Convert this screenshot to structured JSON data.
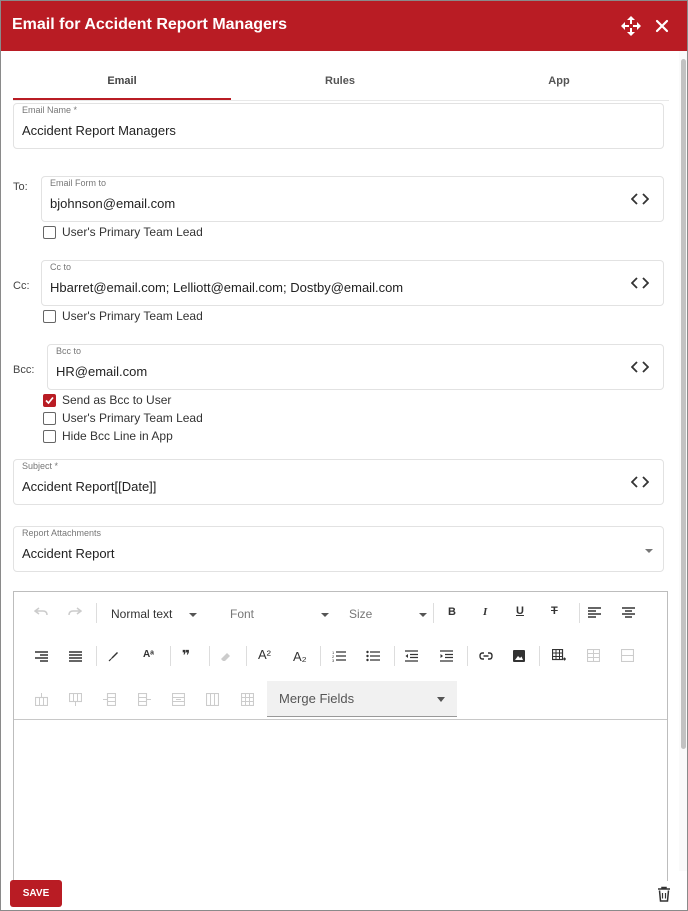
{
  "dialog": {
    "title": "Email for Accident Report Managers"
  },
  "tabs": [
    {
      "label": "Email",
      "active": true
    },
    {
      "label": "Rules",
      "active": false
    },
    {
      "label": "App",
      "active": false
    }
  ],
  "email_name": {
    "label": "Email Name *",
    "value": "Accident Report Managers"
  },
  "to": {
    "row_label": "To:",
    "field_label": "Email Form to",
    "value": "bjohnson@email.com",
    "checkboxes": [
      {
        "label": "User's Primary Team Lead",
        "checked": false
      }
    ]
  },
  "cc": {
    "row_label": "Cc:",
    "field_label": "Cc to",
    "value": "Hbarret@email.com; Lelliott@email.com; Dostby@email.com",
    "checkboxes": [
      {
        "label": "User's Primary Team Lead",
        "checked": false
      }
    ]
  },
  "bcc": {
    "row_label": "Bcc:",
    "field_label": "Bcc to",
    "value": "HR@email.com",
    "checkboxes": [
      {
        "label": "Send as Bcc to User",
        "checked": true
      },
      {
        "label": "User's Primary Team Lead",
        "checked": false
      },
      {
        "label": "Hide Bcc Line in App",
        "checked": false
      }
    ]
  },
  "subject": {
    "label": "Subject *",
    "value": "Accident Report[[Date]]"
  },
  "attachments": {
    "label": "Report Attachments",
    "value": "Accident Report"
  },
  "editor": {
    "paragraph_format": "Normal text",
    "font": "Font",
    "size": "Size",
    "merge_fields": "Merge Fields",
    "toolbar_glyphs": {
      "bold": "B",
      "italic": "I",
      "underline": "U",
      "strike": "T",
      "quote": "❞",
      "superscript": "A²",
      "subscript": "A₂",
      "font_effects": "Aᵃ"
    },
    "body": ""
  },
  "footer": {
    "save_label": "SAVE"
  },
  "colors": {
    "brand": "#b91c24",
    "header_text": "#ffffff"
  },
  "icons": {
    "header": [
      "move-icon",
      "close-icon"
    ],
    "fields": "code-icon",
    "footer": "trash-icon"
  }
}
